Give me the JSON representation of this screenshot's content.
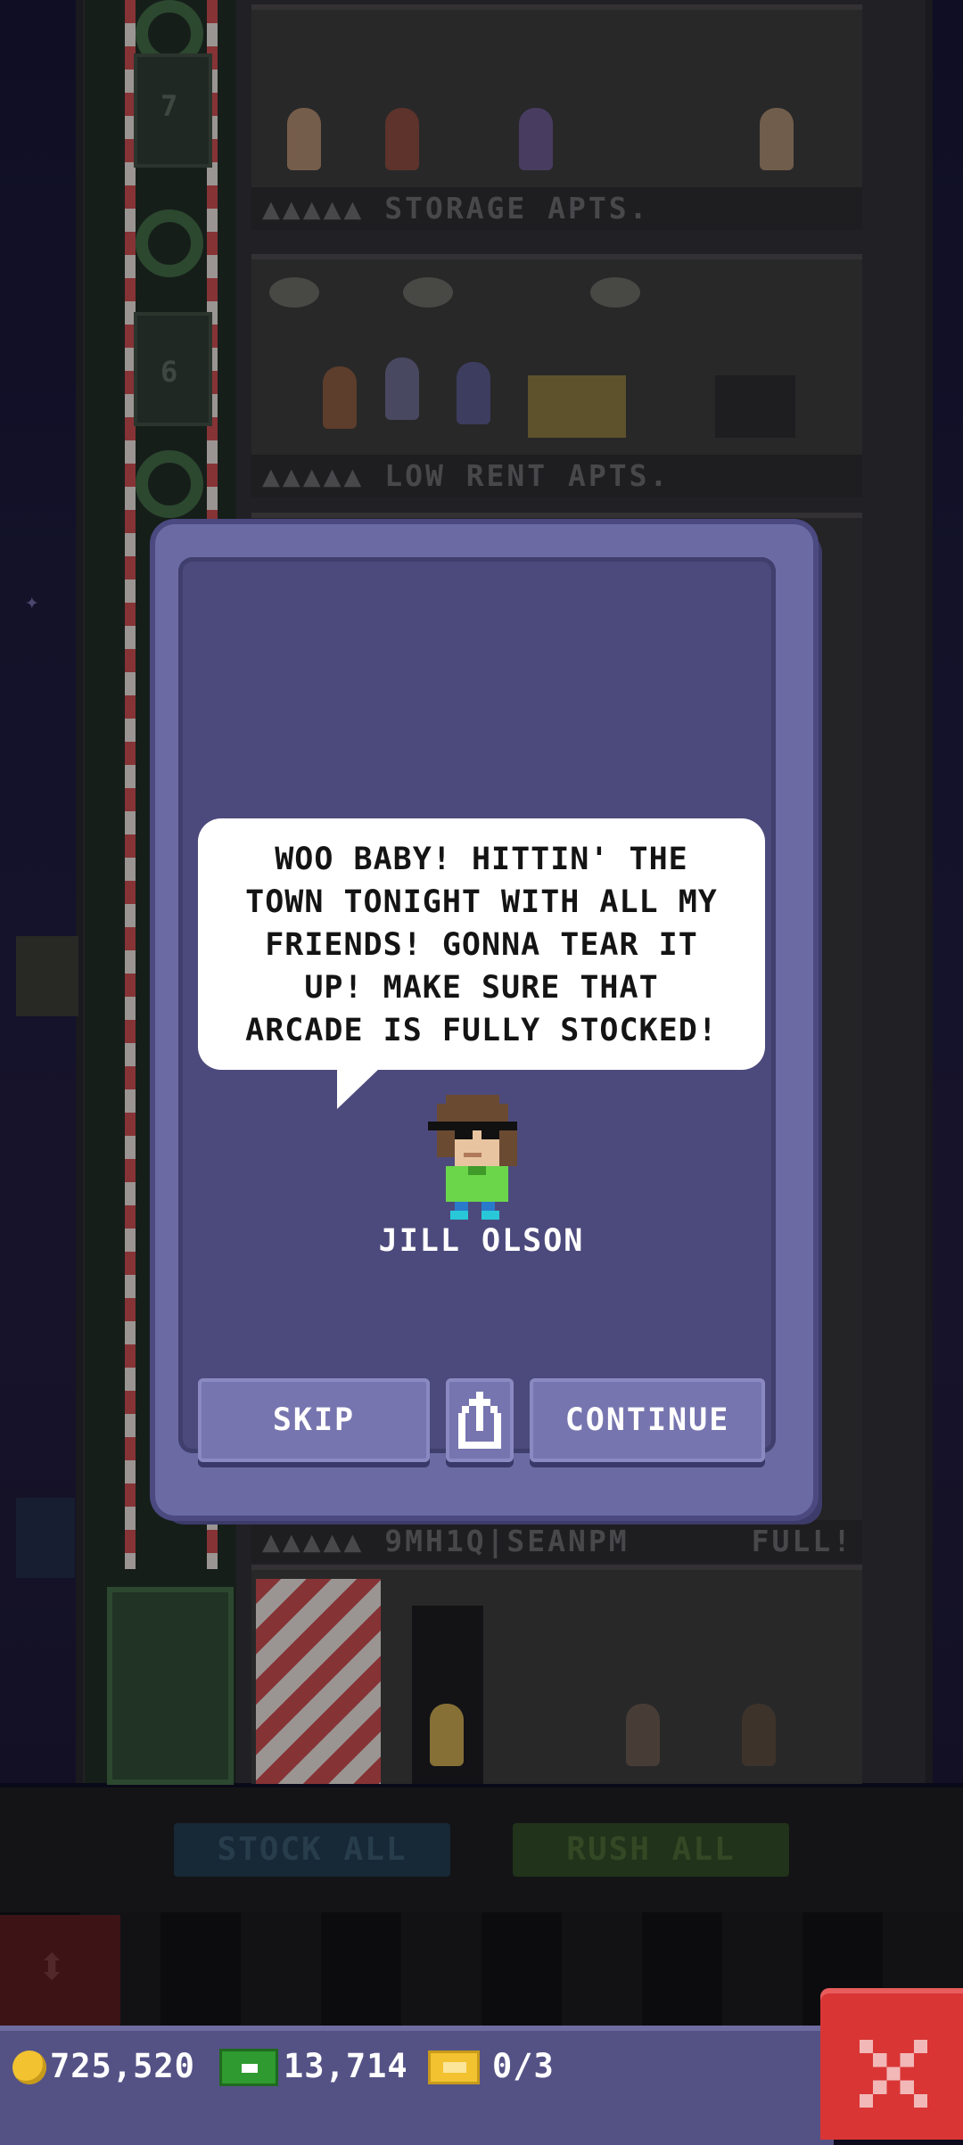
{
  "floors": {
    "storage_label": "STORAGE APTS.",
    "low_rent_label": "LOW RENT APTS.",
    "lower_label": "9MH1Q|SEANPM",
    "lower_status": "FULL!",
    "stars": "▲▲▲▲▲",
    "floor_7": "7",
    "floor_6": "6"
  },
  "toolbar": {
    "stock_all": "STOCK ALL",
    "rush_all": "RUSH ALL"
  },
  "dialog": {
    "message": "WOO BABY! HITTIN' THE\nTOWN TONIGHT WITH ALL MY\nFRIENDS! GONNA TEAR IT\nUP! MAKE SURE THAT\nARCADE IS FULLY STOCKED!",
    "character_name": "JILL OLSON",
    "skip_label": "SKIP",
    "continue_label": "CONTINUE",
    "share_icon": "share-icon"
  },
  "status_bar": {
    "coins": "725,520",
    "bux": "13,714",
    "tickets": "0/3",
    "coin_icon": "coin-icon",
    "bux_icon": "bux-icon",
    "ticket_icon": "ticket-icon",
    "close_icon": "close-icon"
  },
  "colors": {
    "dialog_bg": "#4c4a7c",
    "dialog_frame": "#6c6aa3",
    "button": "#7775af",
    "close": "#d93535",
    "status_bar": "#545285"
  }
}
